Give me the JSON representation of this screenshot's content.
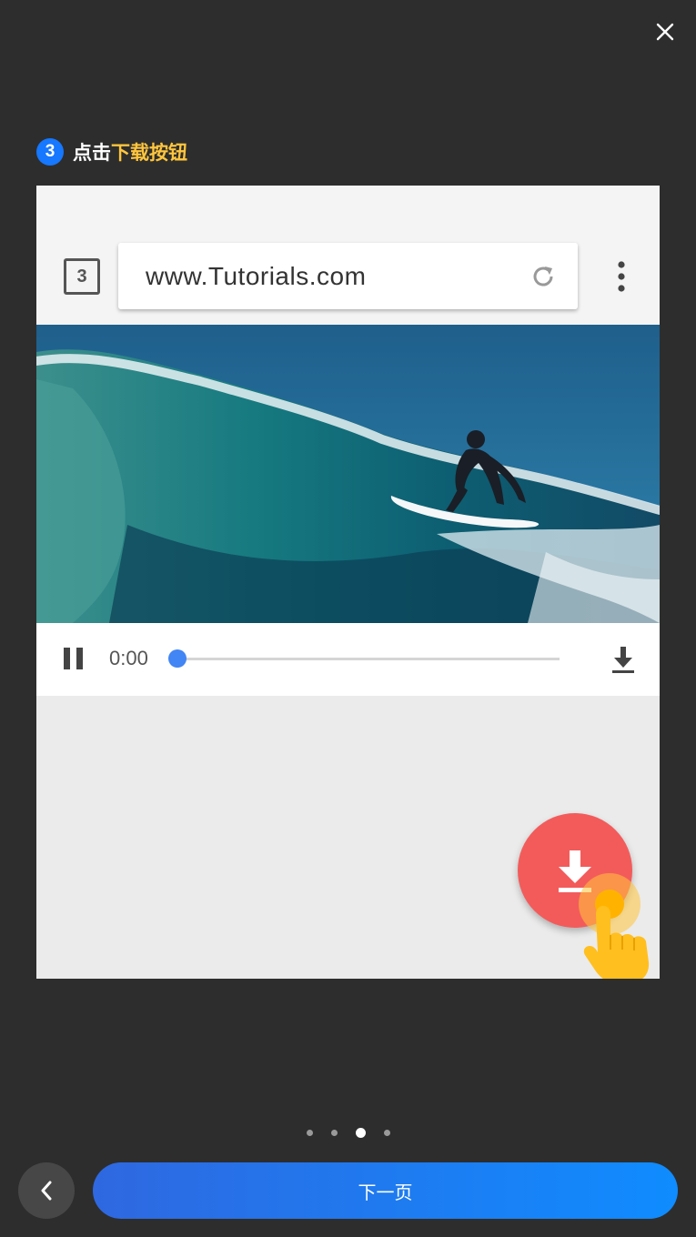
{
  "dialog": {
    "close_icon": "close-icon",
    "step": {
      "number": "3",
      "text": "点击",
      "highlight": "下载按钮",
      "highlight_color": "#ffc53d",
      "badge_color": "#1677ff"
    }
  },
  "illustration": {
    "browser": {
      "tab_count": "3",
      "url": "www.Tutorials.com",
      "reload_icon": "reload-icon",
      "menu_icon": "more-vert-icon"
    },
    "video": {
      "image_subject": "surfer riding a wave",
      "time": "0:00",
      "progress": 0,
      "pause_icon": "pause-icon",
      "download_icon": "download-icon"
    },
    "fab": {
      "icon": "download-icon",
      "color": "#f35b5b"
    },
    "pointer_icon": "hand-pointer-icon"
  },
  "pager": {
    "total": 4,
    "active_index": 2
  },
  "footer": {
    "back_icon": "chevron-left-icon",
    "next_label": "下一页",
    "next_color": "#0f8cff"
  }
}
